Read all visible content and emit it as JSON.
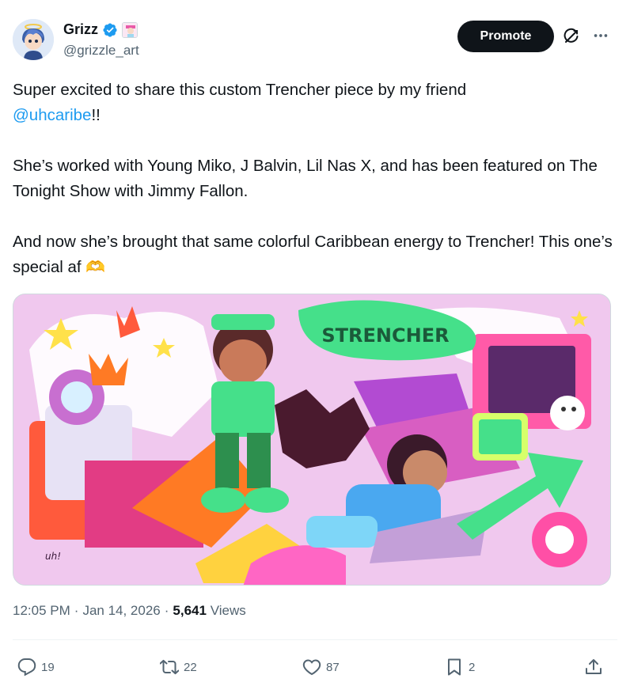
{
  "author": {
    "display_name": "Grizz",
    "handle": "@grizzle_art",
    "verified_color": "#1d9bf0"
  },
  "header": {
    "promote_label": "Promote",
    "grok_icon": "grok-icon",
    "more_icon": "more-horizontal-icon"
  },
  "post": {
    "line1_text": "Super excited to share this custom Trencher piece by my friend",
    "mention": "@uhcaribe",
    "mention_suffix": "!!",
    "paragraph2": "She’s worked with Young Miko, J Balvin, Lil Nas X, and has been featured on The Tonight Show with Jimmy Fallon.",
    "paragraph3": "And now she’s brought that same colorful Caribbean energy to Trencher! This one’s special af",
    "emoji": "🫶",
    "image_text": "STRENCHER"
  },
  "meta": {
    "time": "12:05 PM",
    "sep1": "·",
    "date": "Jan 14, 2026",
    "sep2": "·",
    "views_count": "5,641",
    "views_label": "Views"
  },
  "actions": {
    "replies": "19",
    "reposts": "22",
    "likes": "87",
    "bookmarks": "2"
  },
  "colors": {
    "text": "#0f1419",
    "muted": "#536471",
    "accent": "#1d9bf0",
    "media_bg": "#f0c8ee"
  }
}
